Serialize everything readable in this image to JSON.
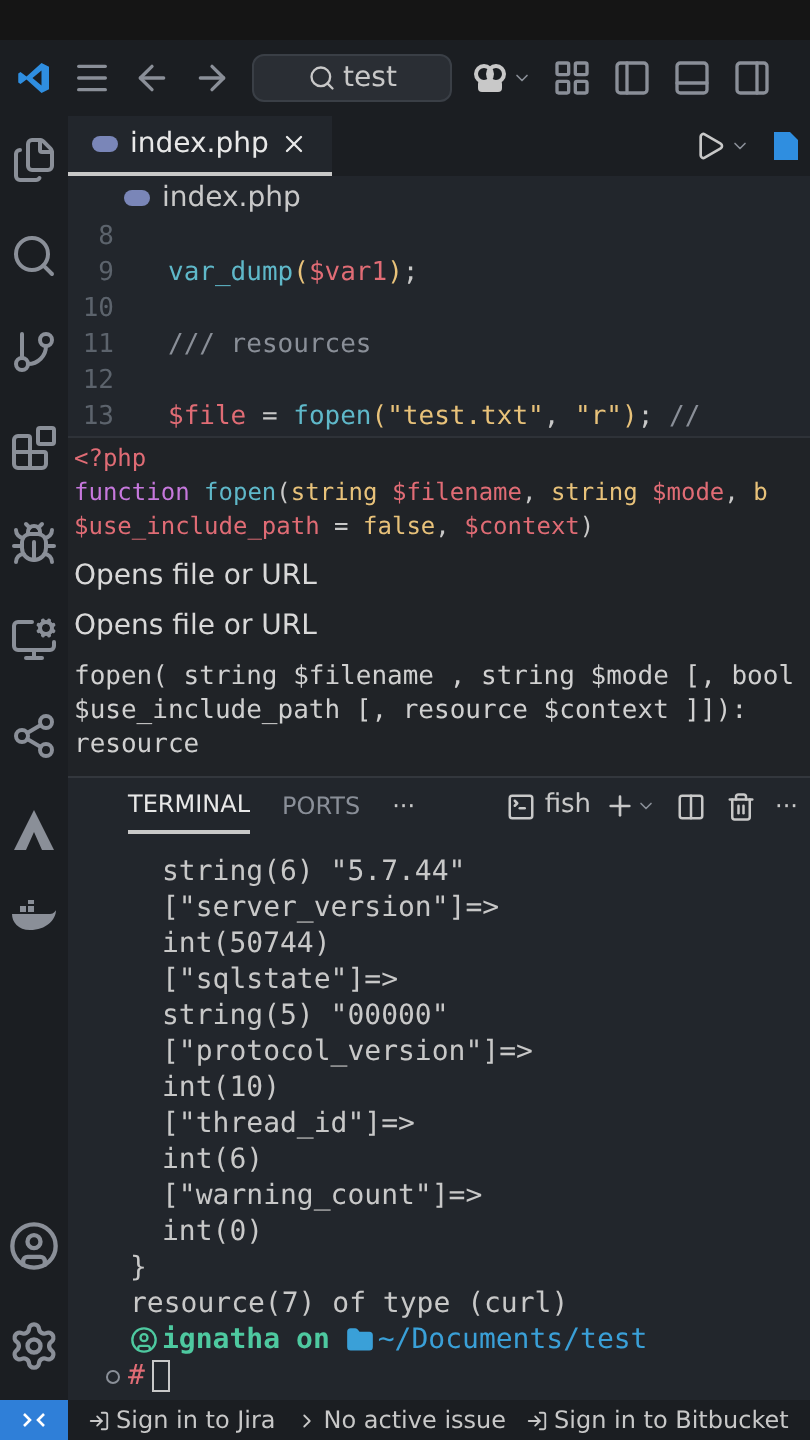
{
  "title_bar": {
    "search": "test"
  },
  "tabs": [
    {
      "label": "index.php",
      "selected": true
    }
  ],
  "breadcrumb": "index.php",
  "editor": {
    "lines": [
      {
        "number": "8"
      },
      {
        "number": "9",
        "tokens": [
          {
            "kind": "fn",
            "text": "var_dump"
          },
          {
            "kind": "paren",
            "text": "("
          },
          {
            "kind": "var",
            "text": "$var1"
          },
          {
            "kind": "paren",
            "text": ")"
          },
          {
            "kind": "plain",
            "text": ";"
          }
        ]
      },
      {
        "number": "10"
      },
      {
        "number": "11",
        "tokens": [
          {
            "kind": "comment",
            "text": "/// resources"
          }
        ]
      },
      {
        "number": "12"
      },
      {
        "number": "13",
        "tokens": [
          {
            "kind": "var",
            "text": "$file"
          },
          {
            "kind": "plain",
            "text": " = "
          },
          {
            "kind": "fn",
            "text": "fopen"
          },
          {
            "kind": "paren",
            "text": "("
          },
          {
            "kind": "string",
            "text": "\"test.txt\""
          },
          {
            "kind": "plain",
            "text": ", "
          },
          {
            "kind": "string",
            "text": "\"r\""
          },
          {
            "kind": "paren",
            "text": ")"
          },
          {
            "kind": "plain",
            "text": "; "
          },
          {
            "kind": "comment",
            "text": "//"
          }
        ]
      }
    ]
  },
  "hover": {
    "signature": [
      [
        {
          "kind": "var",
          "text": "<?php"
        }
      ],
      [
        {
          "kind": "keyword",
          "text": "function"
        },
        {
          "kind": "fn",
          "text": " fopen"
        },
        {
          "kind": "plain",
          "text": "("
        },
        {
          "kind": "type",
          "text": "string"
        },
        {
          "kind": "var",
          "text": " $filename"
        },
        {
          "kind": "plain",
          "text": ", "
        },
        {
          "kind": "type",
          "text": "string"
        },
        {
          "kind": "var",
          "text": " $mode"
        },
        {
          "kind": "plain",
          "text": ", "
        },
        {
          "kind": "type",
          "text": "b"
        }
      ],
      [
        {
          "kind": "var",
          "text": "$use_include_path"
        },
        {
          "kind": "plain",
          "text": " = "
        },
        {
          "kind": "type",
          "text": "false"
        },
        {
          "kind": "plain",
          "text": ", "
        },
        {
          "kind": "var",
          "text": "$context"
        },
        {
          "kind": "plain",
          "text": ")"
        }
      ]
    ],
    "descriptions": [
      "Opens file or URL",
      "Opens file or URL"
    ],
    "doc_lines": [
      "fopen( string $filename , string $mode [, bool",
      "$use_include_path [, resource $context ]]):",
      "resource"
    ]
  },
  "panel": {
    "tabs": [
      {
        "label": "TERMINAL",
        "selected": true
      },
      {
        "label": "PORTS",
        "selected": false
      }
    ],
    "more": "···",
    "shell": "fish",
    "actions_more": "···"
  },
  "terminal": {
    "lines": [
      {
        "kind": "nested",
        "text": "string(6) \"5.7.44\""
      },
      {
        "kind": "nested",
        "text": "[\"server_version\"]=>"
      },
      {
        "kind": "nested",
        "text": "int(50744)"
      },
      {
        "kind": "nested",
        "text": "[\"sqlstate\"]=>"
      },
      {
        "kind": "nested",
        "text": "string(5) \"00000\""
      },
      {
        "kind": "nested",
        "text": "[\"protocol_version\"]=>"
      },
      {
        "kind": "nested",
        "text": "int(10)"
      },
      {
        "kind": "nested",
        "text": "[\"thread_id\"]=>"
      },
      {
        "kind": "nested",
        "text": "int(6)"
      },
      {
        "kind": "nested",
        "text": "[\"warning_count\"]=>"
      },
      {
        "kind": "nested",
        "text": "int(0)"
      },
      {
        "kind": "top",
        "text": "}"
      },
      {
        "kind": "top",
        "text": "resource(7) of type (curl)"
      }
    ],
    "prompt": {
      "user": "ignatha",
      "on": "on",
      "path": "~/Documents/test",
      "symbol": "#"
    }
  },
  "status_bar": {
    "items": [
      "Sign in to Jira",
      "No active issue",
      "Sign in to Bitbucket"
    ]
  }
}
